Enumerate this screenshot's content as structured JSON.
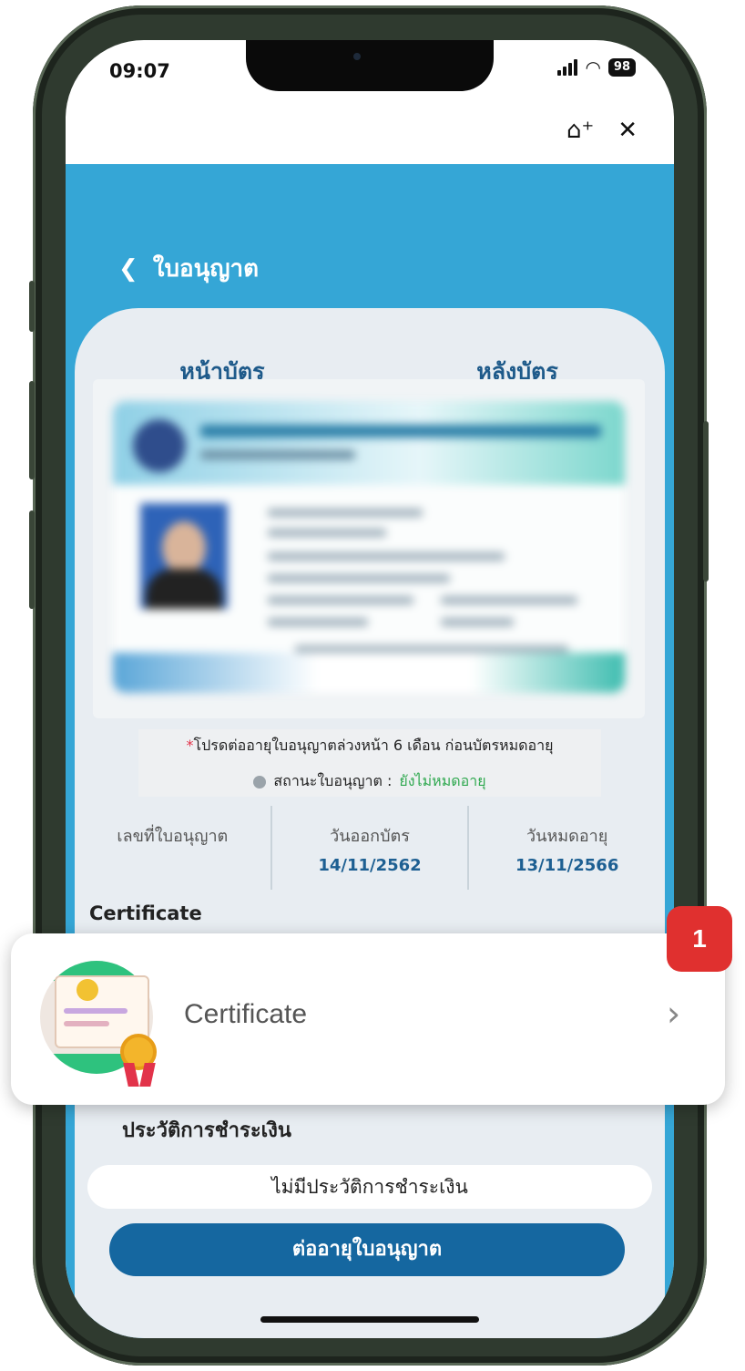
{
  "status_bar": {
    "time": "09:07",
    "battery": "98"
  },
  "header": {
    "title": "ใบอนุญาต"
  },
  "tabs": [
    {
      "label": "หน้าบัตร"
    },
    {
      "label": "หลังบัตร"
    }
  ],
  "notice": {
    "star": "*",
    "renew_hint": "โปรดต่ออายุใบอนุญาตล่วงหน้า 6 เดือน ก่อนบัตรหมดอายุ",
    "status_label": "สถานะใบอนุญาต :",
    "status_value": "ยังไม่หมดอายุ"
  },
  "license_info": {
    "number_label": "เลขที่ใบอนุญาต",
    "issue_label": "วันออกบัตร",
    "issue_date": "14/11/2562",
    "expire_label": "วันหมดอายุ",
    "expire_date": "13/11/2566"
  },
  "certificate_section": {
    "title": "Certificate",
    "item_label": "Certificate"
  },
  "payment": {
    "title": "ประวัติการชำระเงิน",
    "empty_text": "ไม่มีประวัติการชำระเงิน",
    "renew_button": "ต่ออายุใบอนุญาต"
  },
  "step_badge": "1",
  "colors": {
    "header_blue": "#35a6d6",
    "primary_button": "#1567a0",
    "badge_red": "#e0302f",
    "status_green": "#2fa84f"
  },
  "icons": [
    "back-chevron-icon",
    "add-to-home-icon",
    "close-icon",
    "signal-icon",
    "wifi-icon",
    "battery-icon",
    "certificate-icon",
    "chevron-right-icon",
    "status-dot-icon"
  ]
}
